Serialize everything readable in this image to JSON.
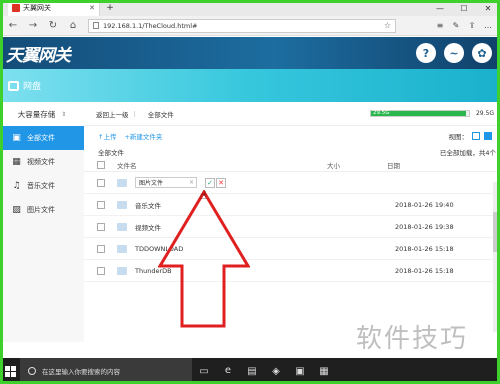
{
  "browser": {
    "tab_title": "天翼网关",
    "url": "192.168.1.1/TheCloud.html#",
    "window_buttons": [
      "—",
      "☐",
      "✕"
    ]
  },
  "app": {
    "logo": "天翼网关",
    "banner_title": "网盘"
  },
  "sidebar": {
    "header": "大容量存储",
    "items": [
      {
        "label": "全部文件",
        "icon": "folder-icon"
      },
      {
        "label": "视频文件",
        "icon": "video-icon"
      },
      {
        "label": "音乐文件",
        "icon": "music-icon"
      },
      {
        "label": "图片文件",
        "icon": "image-icon"
      }
    ]
  },
  "toolbar": {
    "back": "返回上一级",
    "path": "全部文件",
    "storage_used_label": "29.5G",
    "storage_total_label": "29.5G",
    "storage_fraction": 0.97
  },
  "actions": {
    "upload": "上传",
    "new_folder": "新建文件夹",
    "view_label": "视图："
  },
  "path_row": {
    "path": "全部文件",
    "count": "已全部加载，共4个"
  },
  "table": {
    "headers": {
      "name": "文件名",
      "size": "大小",
      "date": "日期"
    },
    "rename_value": "图片文件",
    "rows": [
      {
        "name": "音乐文件",
        "date": "2018-01-26 19:40"
      },
      {
        "name": "视频文件",
        "date": "2018-01-26 19:38"
      },
      {
        "name": "TDDOWNLOAD",
        "date": "2018-01-26 15:18"
      },
      {
        "name": "ThunderDB",
        "date": "2018-01-26 15:18"
      }
    ]
  },
  "taskbar": {
    "search_placeholder": "在这里输入你要搜索的内容"
  },
  "watermark": "软件技巧",
  "colors": {
    "accent": "#2196e6",
    "header": "#1d6da0",
    "banner": "#36c7dd",
    "storage": "#2ab74e",
    "frame": "#3fd12b",
    "arrow": "#e02020"
  }
}
